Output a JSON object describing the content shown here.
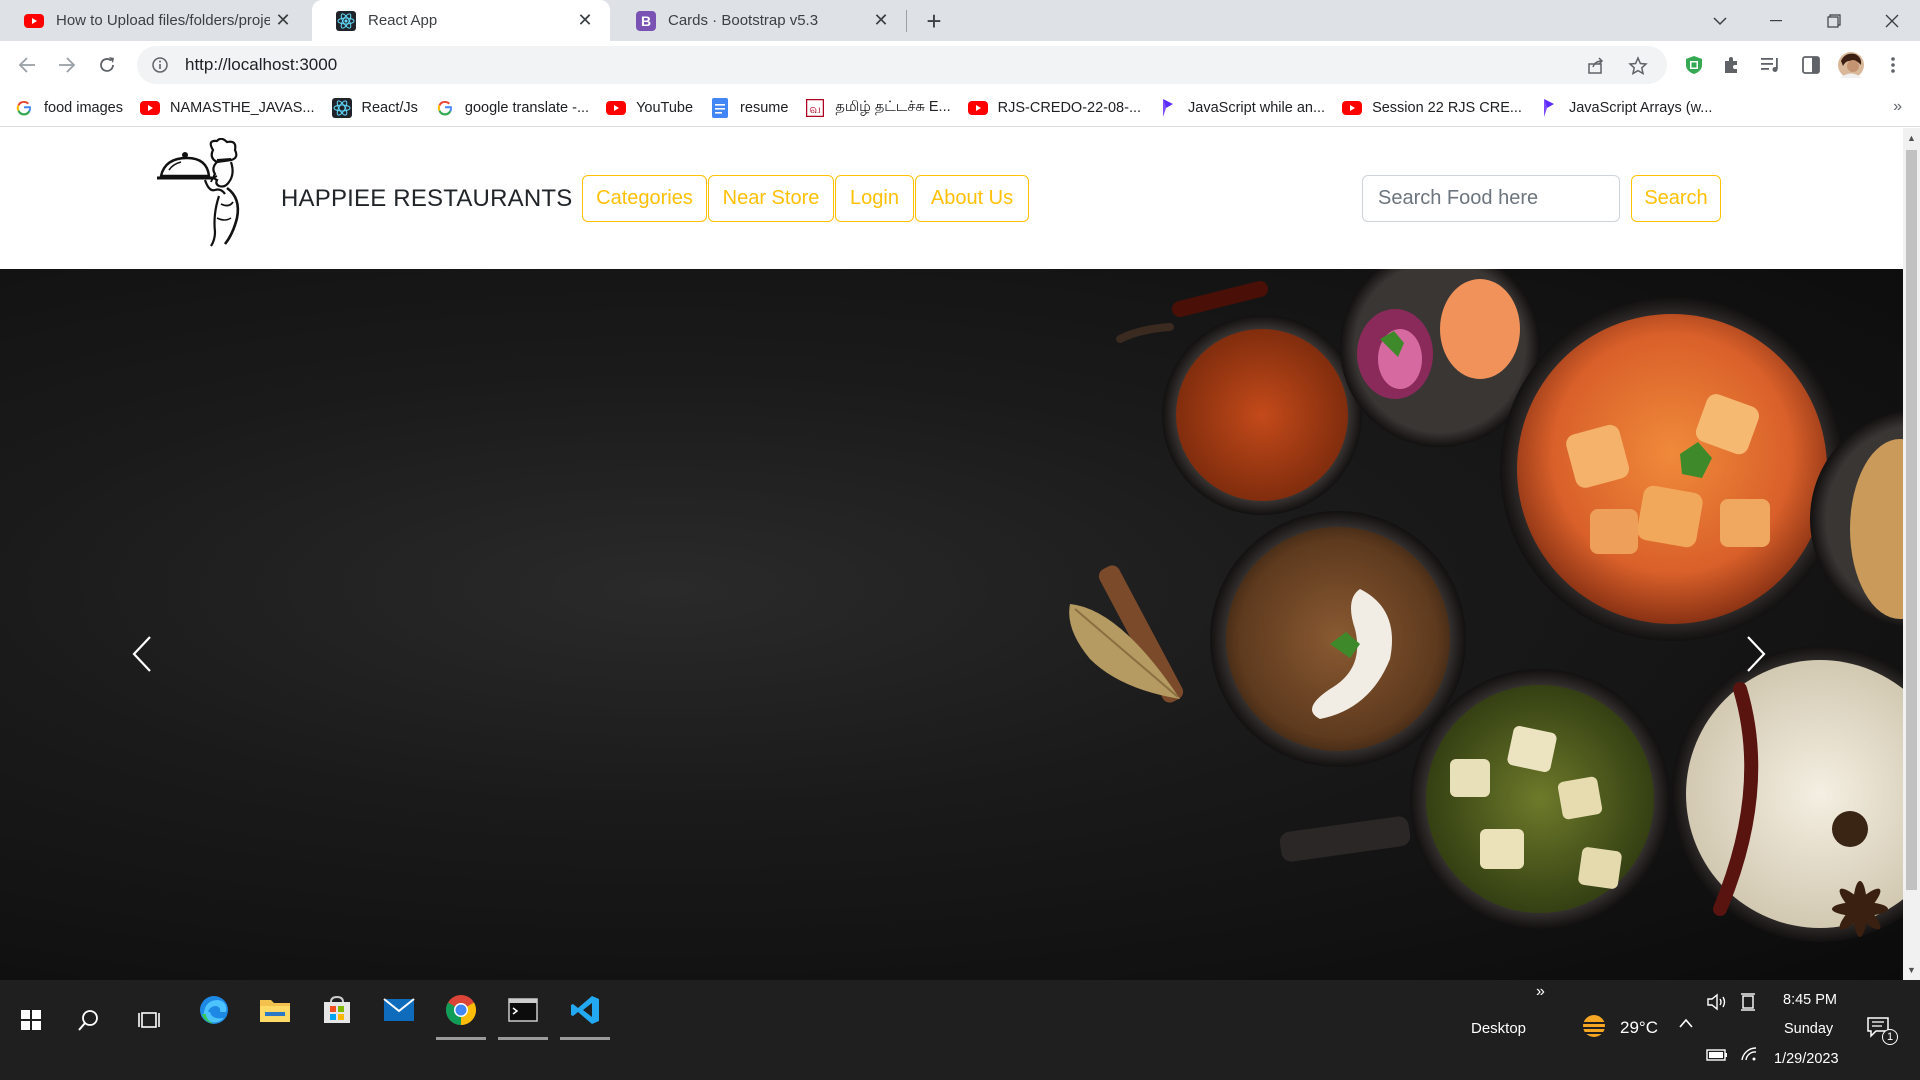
{
  "browser": {
    "tabs": [
      {
        "title": "How to Upload files/folders/proje",
        "icon": "youtube-icon",
        "active": false
      },
      {
        "title": "React App",
        "icon": "react-icon",
        "active": true
      },
      {
        "title": "Cards · Bootstrap v5.3",
        "icon": "bootstrap-icon",
        "active": false
      }
    ],
    "new_tab_label": "+",
    "url": "http://localhost:3000",
    "bookmarks": [
      {
        "label": "food images",
        "icon": "google-icon"
      },
      {
        "label": "NAMASTHE_JAVAS...",
        "icon": "youtube-icon"
      },
      {
        "label": "React/Js",
        "icon": "react-icon"
      },
      {
        "label": "google translate -...",
        "icon": "google-icon"
      },
      {
        "label": "YouTube",
        "icon": "youtube-icon"
      },
      {
        "label": "resume",
        "icon": "docs-icon"
      },
      {
        "label": "தமிழ் தட்டச்சு E...",
        "icon": "tamil-icon"
      },
      {
        "label": "RJS-CREDO-22-08-...",
        "icon": "youtube-icon"
      },
      {
        "label": "JavaScript while an...",
        "icon": "programiz-icon"
      },
      {
        "label": "Session 22 RJS CRE...",
        "icon": "youtube-icon"
      },
      {
        "label": "JavaScript Arrays (w...",
        "icon": "programiz-icon"
      }
    ],
    "bookmarks_more": "»"
  },
  "site": {
    "brand": "HAPPIEE RESTAURANTS",
    "nav": {
      "categories": "Categories",
      "near_store": "Near Store",
      "login": "Login",
      "about": "About Us"
    },
    "search": {
      "placeholder": "Search Food here",
      "button": "Search"
    },
    "accent_color": "#ffc107"
  },
  "taskbar": {
    "desktop_label": "Desktop",
    "weather": "29°C",
    "time": "8:45 PM",
    "day": "Sunday",
    "date": "1/29/2023",
    "notification_count": "1",
    "overflow": "»"
  }
}
